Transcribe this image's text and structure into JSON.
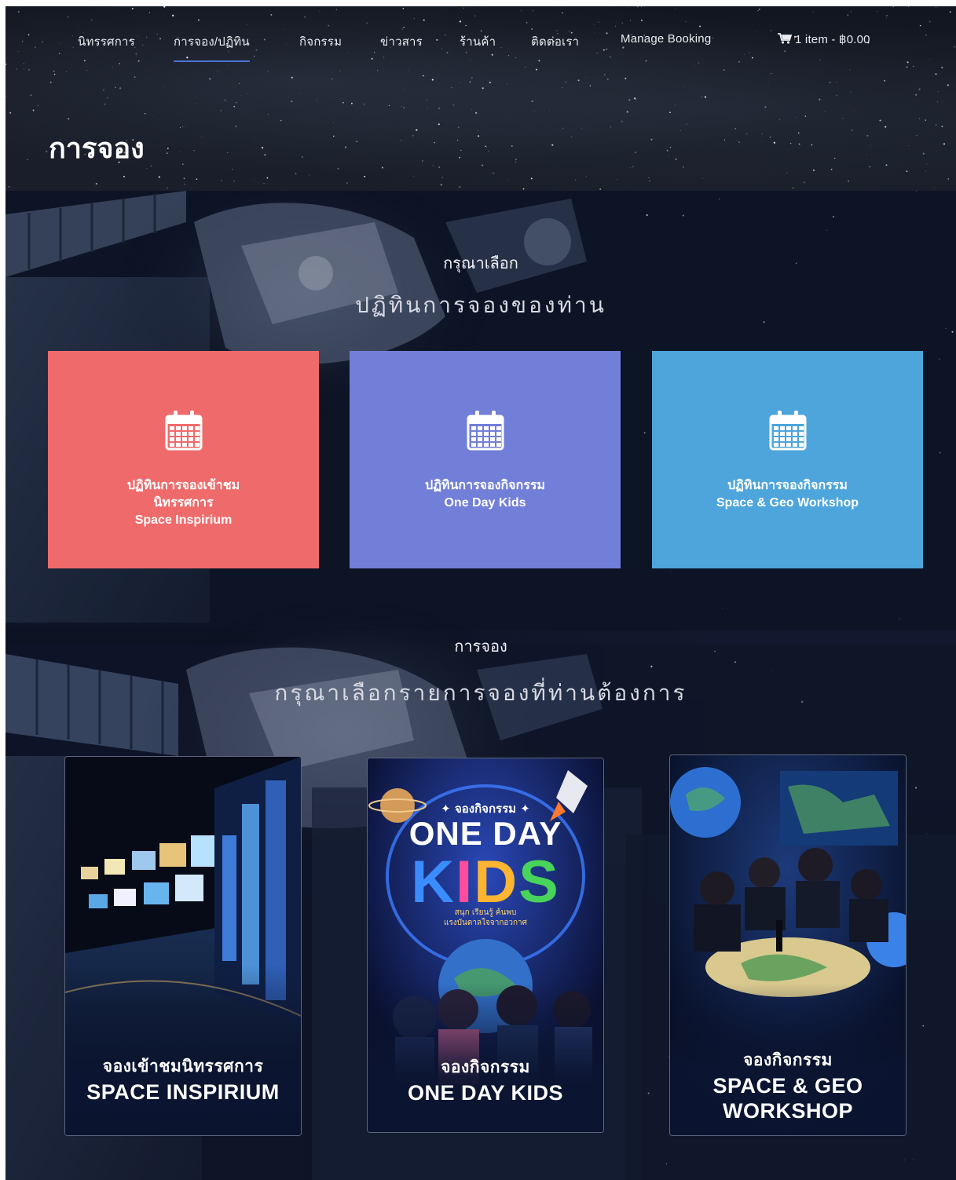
{
  "nav": {
    "items": [
      {
        "label": "นิทรรศการ",
        "active": false
      },
      {
        "label": "การจอง/ปฏิทิน",
        "active": true
      },
      {
        "label": "กิจกรรม",
        "active": false
      },
      {
        "label": "ข่าวสาร",
        "active": false
      },
      {
        "label": "ร้านค้า",
        "active": false
      },
      {
        "label": "ติดต่อเรา",
        "active": false
      },
      {
        "label": "Manage Booking",
        "active": false
      }
    ],
    "cart": "1 item - ฿0.00",
    "cart_icon": "shopping-cart-icon"
  },
  "page_title": "การจอง",
  "calendar_section": {
    "subtitle": "กรุณาเลือก",
    "title": "ปฏิทินการจองของท่าน",
    "icon": "calendar-icon",
    "boxes": [
      {
        "color": "#ef6b6b",
        "lines": [
          "ปฏิทินการจองเข้าชม",
          "นิทรรศการ",
          "Space Inspirium"
        ]
      },
      {
        "color": "#727fd8",
        "lines": [
          "ปฏิทินการจองกิจกรรม",
          "One Day Kids"
        ]
      },
      {
        "color": "#4ea5dc",
        "lines": [
          "ปฏิทินการจองกิจกรรม",
          "Space & Geo Workshop"
        ]
      }
    ]
  },
  "booking_section": {
    "subtitle": "การจอง",
    "title": "กรุณาเลือกรายการจองที่ท่านต้องการ",
    "cards": [
      {
        "line1": "จองเข้าชมนิทรรศการ",
        "line2": "SPACE INSPIRIUM"
      },
      {
        "line1": "จองกิจกรรม",
        "line2": "ONE DAY KIDS",
        "poster": {
          "kicker": "✦ จองกิจกรรม ✦",
          "one_day": "ONE DAY",
          "kids": [
            "K",
            "I",
            "D",
            "S"
          ],
          "tagline": [
            "สนุก เรียนรู้ ค้นพบ",
            "แรงบันดาลใจจากอวกาศ"
          ]
        }
      },
      {
        "line1": "จองกิจกรรม",
        "line2a": "SPACE & GEO",
        "line2b": "WORKSHOP"
      }
    ]
  }
}
